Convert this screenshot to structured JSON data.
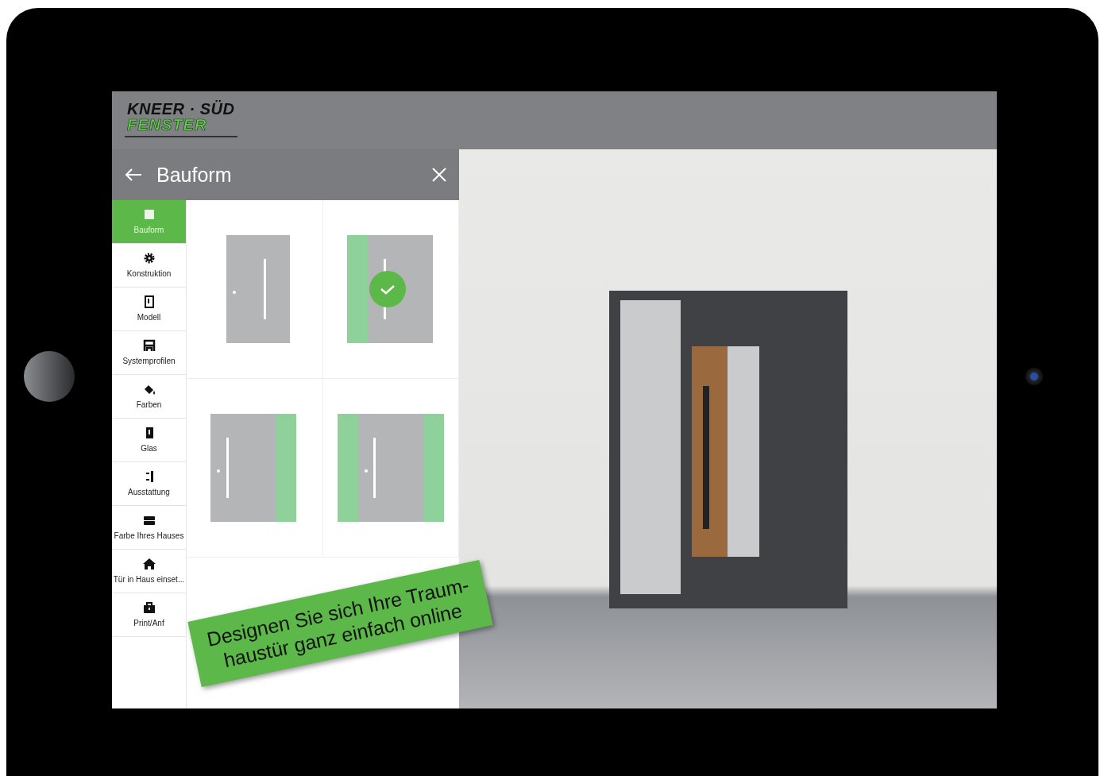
{
  "header": {
    "logo_line_1": "KNEER · SÜD",
    "logo_line_2": "FENSTER"
  },
  "panel": {
    "title": "Bauform"
  },
  "sidebar": {
    "items": [
      {
        "label": "Bauform",
        "selected": true
      },
      {
        "label": "Konstruktion",
        "selected": false
      },
      {
        "label": "Modell",
        "selected": false
      },
      {
        "label": "Systemprofilen",
        "selected": false
      },
      {
        "label": "Farben",
        "selected": false
      },
      {
        "label": "Glas",
        "selected": false
      },
      {
        "label": "Ausstattung",
        "selected": false
      },
      {
        "label": "Farbe Ihres Hauses",
        "selected": false
      },
      {
        "label": "Tür in Haus einset...",
        "selected": false
      },
      {
        "label": "Print/Anf",
        "selected": false
      }
    ]
  },
  "options": [
    {
      "kind": "single",
      "selected": false
    },
    {
      "kind": "sidelight-left",
      "selected": true
    },
    {
      "kind": "sidelight-right",
      "selected": false
    },
    {
      "kind": "sidelights-both",
      "selected": false
    }
  ],
  "banner": {
    "text": "Designen Sie sich Ihre Traum-haustür ganz einfach online"
  }
}
